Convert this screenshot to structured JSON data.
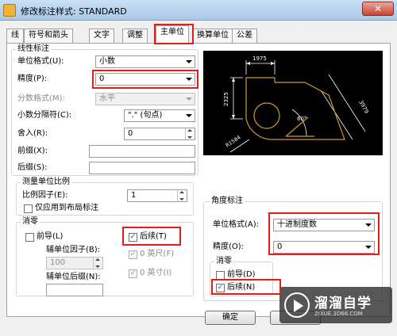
{
  "window": {
    "title": "修改标注样式: STANDARD",
    "close_label": "✕"
  },
  "tabs": [
    {
      "label": "线"
    },
    {
      "label": "符号和箭头"
    },
    {
      "label": "文字"
    },
    {
      "label": "调整"
    },
    {
      "label": "主单位"
    },
    {
      "label": "换算单位"
    },
    {
      "label": "公差"
    }
  ],
  "active_tab": "主单位",
  "linear": {
    "title": "线性标注",
    "unit_format_label": "单位格式(U):",
    "unit_format_value": "小数",
    "precision_label": "精度(P):",
    "precision_value": "0",
    "fraction_format_label": "分数格式(M):",
    "fraction_format_value": "水平",
    "decimal_separator_label": "小数分隔符(C):",
    "decimal_separator_value": "\".\" (句点)",
    "roundoff_label": "舍入(R):",
    "roundoff_value": "0",
    "prefix_label": "前缀(X):",
    "prefix_value": "",
    "suffix_label": "后缀(S):",
    "suffix_value": ""
  },
  "measurement_scale": {
    "title": "测量单位比例",
    "scale_label": "比例因子(E):",
    "scale_value": "1",
    "layout_only_label": "仅应用到布局标注"
  },
  "zero_suppression": {
    "title": "消零",
    "leading_label": "前导(L)",
    "trailing_label": "后续(T)",
    "sub_units_factor_label": "辅单位因子(B):",
    "sub_units_factor_value": "100",
    "sub_units_suffix_label": "辅单位后缀(N):",
    "sub_units_suffix_value": "",
    "feet_label": "0 英尺(F)",
    "inches_label": "0 英寸(I)"
  },
  "angular": {
    "title": "角度标注",
    "unit_format_label": "单位格式(A):",
    "unit_format_value": "十进制度数",
    "precision_label": "精度(O):",
    "precision_value": "0"
  },
  "angular_zero": {
    "title": "消零",
    "leading_label": "前导(D)",
    "trailing_label": "后续(N)"
  },
  "preview": {
    "dim_top": "1975",
    "dim_left": "2325",
    "dim_right": "3979",
    "dim_angle": "60°",
    "dim_radius": "R1584"
  },
  "buttons": {
    "ok_label": "确定"
  },
  "watermark": {
    "brand": "溜溜自学",
    "url": "ZIXUE.3D66.COM"
  },
  "colors": {
    "highlight": "#e21b1b",
    "preview_bg": "#000000",
    "preview_shape": "#d09a2c",
    "preview_dim": "#ffffff"
  }
}
